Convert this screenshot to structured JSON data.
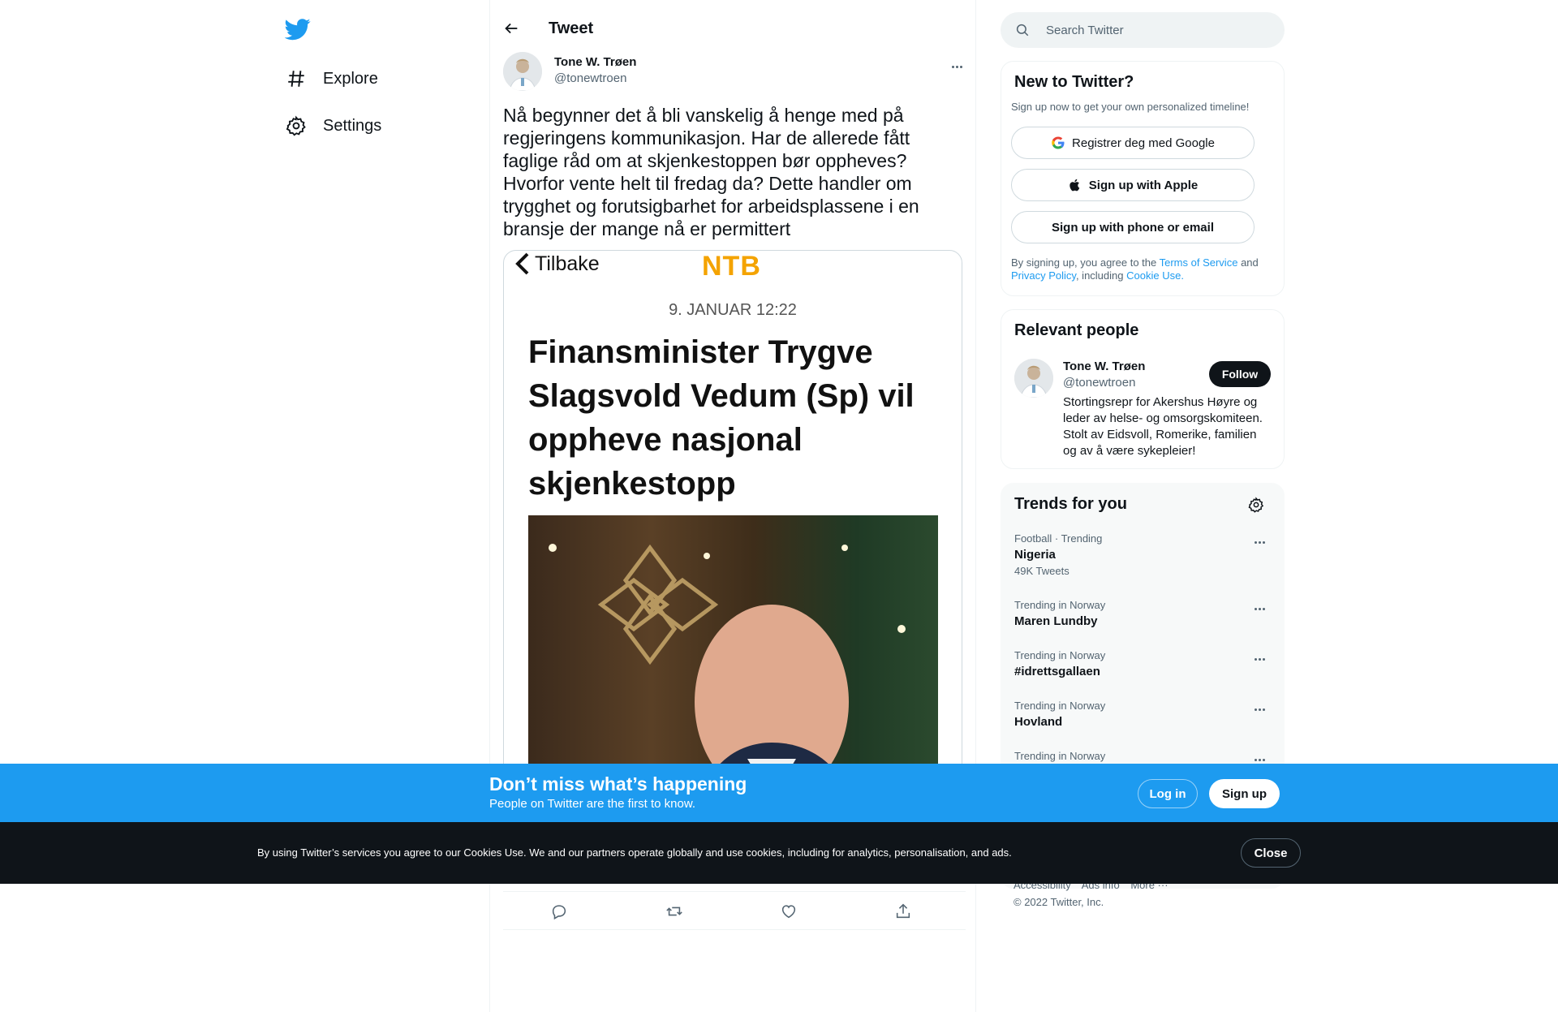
{
  "nav": {
    "logo_icon": "twitter-bird-icon",
    "items": [
      {
        "label": "Explore",
        "icon": "hashtag-icon"
      },
      {
        "label": "Settings",
        "icon": "gear-icon"
      }
    ]
  },
  "header": {
    "title": "Tweet",
    "back_icon": "arrow-left-icon"
  },
  "tweet": {
    "author_name": "Tone W. Trøen",
    "author_handle": "@tonewtroen",
    "text": "Nå begynner det å bli vanskelig å henge med på regjeringens kommunikasjon. Har de allerede fått faglige råd om at skjenkestoppen bør oppheves? Hvorfor vente helt til fredag da? Dette handler om trygghet og forutsigbarhet for arbeidsplassene i en bransje der mange nå er permittert",
    "media": {
      "back_label": "Tilbake",
      "brand": "NTB",
      "date": "9. JANUAR 12:22",
      "headline": "Finansminister Trygve Slagsvold Vedum (Sp) vil oppheve nasjonal skjenkestopp"
    },
    "actions": [
      "reply-icon",
      "retweet-icon",
      "like-icon",
      "share-icon"
    ]
  },
  "search": {
    "placeholder": "Search Twitter"
  },
  "signup_card": {
    "title": "New to Twitter?",
    "subtitle": "Sign up now to get your own personalized timeline!",
    "google_label": "Registrer deg med Google",
    "apple_label": "Sign up with Apple",
    "phone_label": "Sign up with phone or email",
    "legal_prefix": "By signing up, you agree to the",
    "terms_link": "Terms of Service",
    "and": "and",
    "privacy_link": "Privacy Policy",
    "including": ", including",
    "cookie_link": "Cookie Use."
  },
  "relevant_people": {
    "title": "Relevant people",
    "name": "Tone W. Trøen",
    "handle": "@tonewtroen",
    "bio": "Stortingsrepr for Akershus Høyre og leder av helse- og omsorgskomiteen. Stolt av Eidsvoll, Romerike, familien og av å være sykepleier!",
    "follow_label": "Follow"
  },
  "trends": {
    "title": "Trends for you",
    "items": [
      {
        "meta": "Football · Trending",
        "name": "Nigeria",
        "count": "49K Tweets"
      },
      {
        "meta": "Trending in Norway",
        "name": "Maren Lundby",
        "count": ""
      },
      {
        "meta": "Trending in Norway",
        "name": "#idrettsgallaen",
        "count": ""
      },
      {
        "meta": "Trending in Norway",
        "name": "Hovland",
        "count": ""
      },
      {
        "meta": "Trending in Norway",
        "name": "",
        "count": ""
      }
    ]
  },
  "footer": {
    "links": [
      "Accessibility",
      "Ads info",
      "More ···"
    ],
    "copyright": "© 2022 Twitter, Inc."
  },
  "banner": {
    "title": "Don’t miss what’s happening",
    "subtitle": "People on Twitter are the first to know.",
    "login_label": "Log in",
    "signup_label": "Sign up"
  },
  "cookie_bar": {
    "text": "By using Twitter’s services you agree to our Cookies Use. We and our partners operate globally and use cookies, including for analytics, personalisation, and ads.",
    "close_label": "Close"
  },
  "colors": {
    "brand_blue": "#1d9bf0",
    "text_primary": "#0f1419",
    "text_secondary": "#536471",
    "ntb_orange": "#f4a300"
  }
}
